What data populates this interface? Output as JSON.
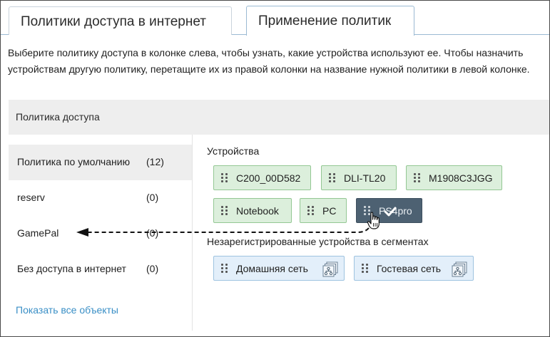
{
  "tabs": {
    "policies_label": "Политики доступа в интернет",
    "apply_label": "Применение политик"
  },
  "description": "Выберите политику доступа в колонке слева, чтобы узнать, какие устройства используют ее. Чтобы назначить устройствам другую политику, перетащите их из правой колонки на название нужной политики в левой колонке.",
  "panel_header": "Политика доступа",
  "policies": [
    {
      "name": "Политика по умолчанию",
      "count": "(12)",
      "selected": true
    },
    {
      "name": "reserv",
      "count": "(0)",
      "selected": false
    },
    {
      "name": "GamePal",
      "count": "(0)",
      "selected": false
    },
    {
      "name": "Без доступа в интернет",
      "count": "(0)",
      "selected": false
    }
  ],
  "show_all_link": "Показать все объекты",
  "devices_label": "Устройства",
  "devices": [
    {
      "name": "C200_00D582"
    },
    {
      "name": "DLI-TL20"
    },
    {
      "name": "M1908C3JGG"
    },
    {
      "name": "Notebook"
    },
    {
      "name": "PC"
    },
    {
      "name": "PS4pro",
      "dragging": true
    }
  ],
  "segments_label": "Незарегистрированные устройства в сегментах",
  "segments": [
    {
      "name": "Домашняя сеть",
      "icon": "network-segment-icon"
    },
    {
      "name": "Гостевая сеть",
      "icon": "network-segment-icon"
    }
  ],
  "colors": {
    "device_bg": "#dcefdc",
    "segment_bg": "#e3effa",
    "dragging_bg": "#4d6172",
    "link": "#3a8fc6"
  }
}
